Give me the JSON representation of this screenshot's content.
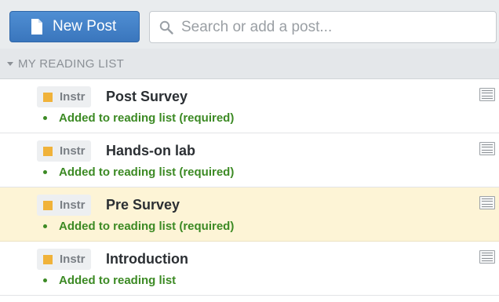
{
  "toolbar": {
    "new_post_label": "New Post",
    "search_placeholder": "Search or add a post..."
  },
  "reading_list": {
    "header": "MY READING LIST",
    "tag_color": "#f0b23a",
    "highlight_color": "#fdf4d6",
    "items": [
      {
        "tag": "Instr",
        "title": "Post Survey",
        "status": "Added to reading list (required)",
        "highlighted": false
      },
      {
        "tag": "Instr",
        "title": "Hands-on lab",
        "status": "Added to reading list (required)",
        "highlighted": false
      },
      {
        "tag": "Instr",
        "title": "Pre Survey",
        "status": "Added to reading list (required)",
        "highlighted": true
      },
      {
        "tag": "Instr",
        "title": "Introduction",
        "status": "Added to reading list",
        "highlighted": false
      }
    ]
  }
}
